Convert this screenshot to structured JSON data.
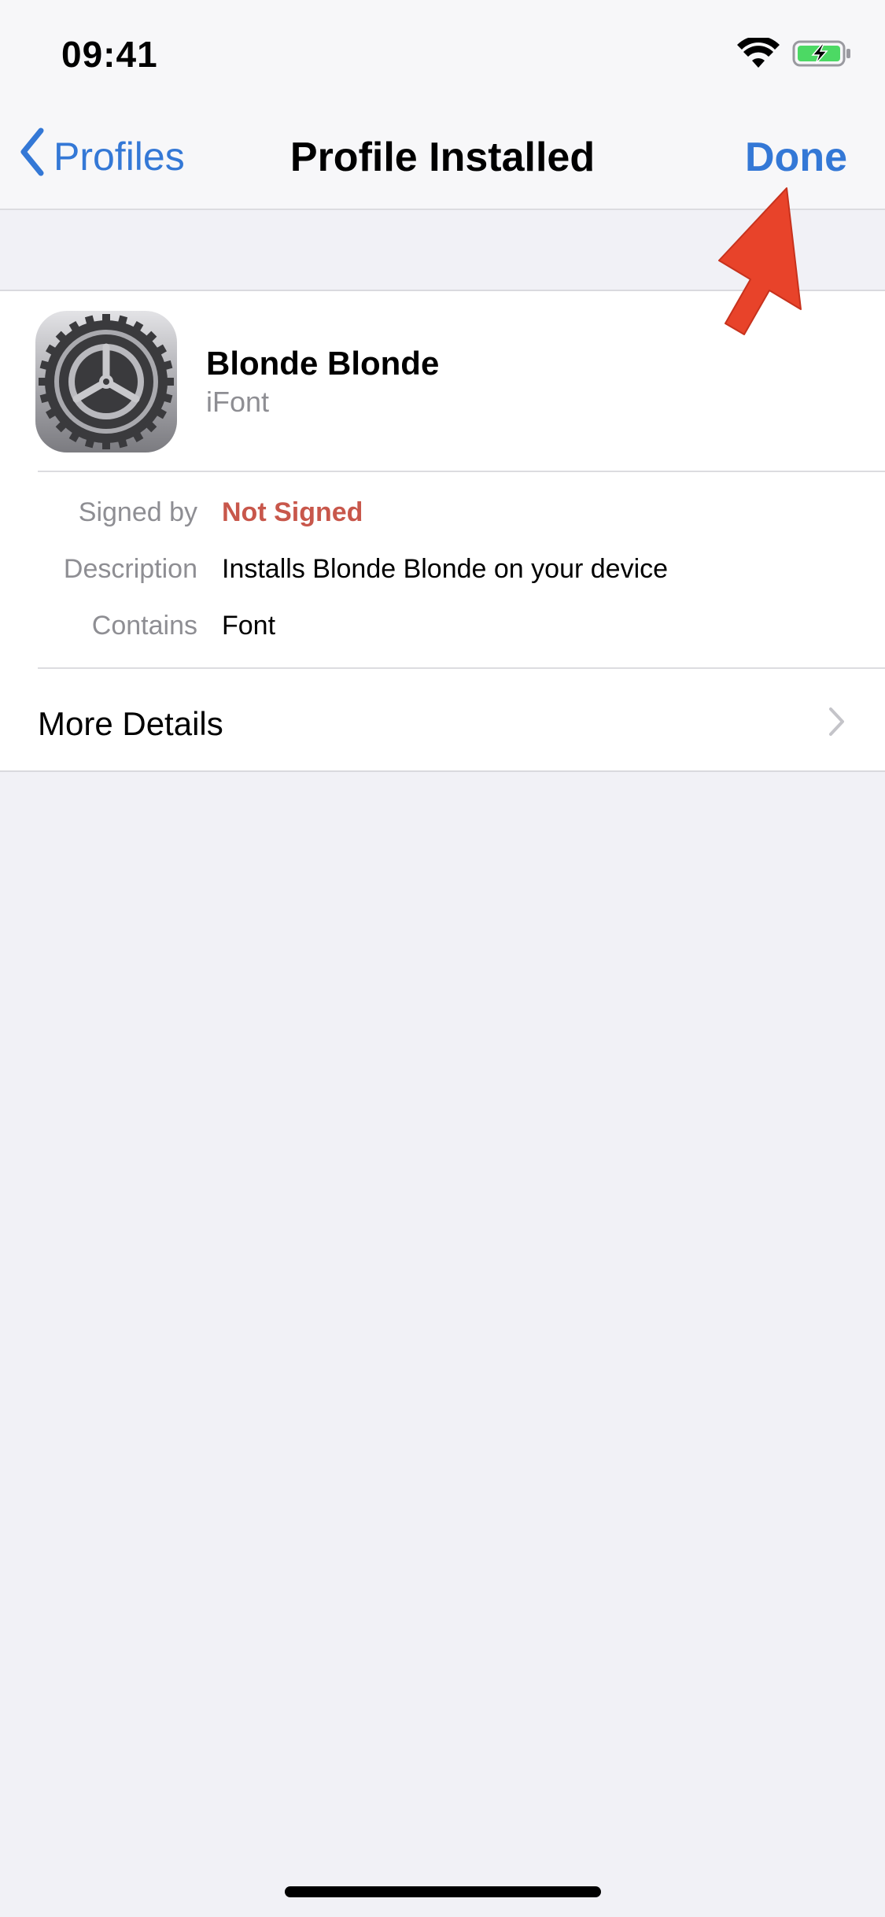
{
  "status_bar": {
    "time": "09:41",
    "icons": [
      "wifi-icon",
      "battery-charging-icon"
    ],
    "battery_color": "#4cd964"
  },
  "nav": {
    "back_label": "Profiles",
    "title": "Profile Installed",
    "done_label": "Done",
    "accent_color": "#3478d6"
  },
  "profile": {
    "name": "Blonde Blonde",
    "organization": "iFont",
    "icon": "settings-gear-icon"
  },
  "details": [
    {
      "label": "Signed by",
      "value": "Not Signed"
    },
    {
      "label": "Description",
      "value": "Installs Blonde Blonde on your device"
    },
    {
      "label": "Contains",
      "value": "Font"
    }
  ],
  "more_details": {
    "label": "More Details"
  },
  "annotation": {
    "icon": "red-arrow-icon",
    "color": "#e8432a"
  }
}
